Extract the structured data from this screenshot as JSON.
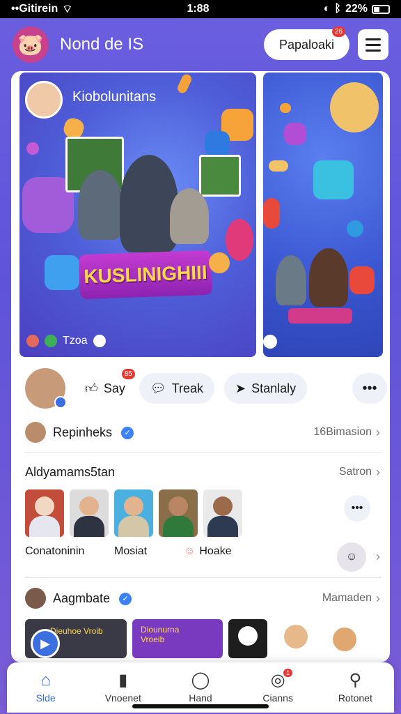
{
  "status": {
    "carrier": "••Gitirein",
    "time": "1:88",
    "battery": "22%"
  },
  "header": {
    "title": "Nond de IS",
    "pill_label": "Papaloaki",
    "pill_badge": "26"
  },
  "banner": {
    "title": "Kiobolunitans",
    "ribbon_text": "KUSLINIGHIII",
    "footer_text": "Tzoa"
  },
  "actions": {
    "say_label": "Say",
    "say_badge": "85",
    "treak_label": "Treak",
    "stanlaly_label": "Stanlaly",
    "more_label": "•••"
  },
  "section1": {
    "title": "Repinheks",
    "link": "16Bimasion"
  },
  "section2": {
    "title": "Aldyamams5tan",
    "link": "Satron",
    "labels": [
      "Conatoninin",
      "Mosiat",
      "Hoake"
    ]
  },
  "section3": {
    "title": "Aagmbate",
    "link": "Mamaden"
  },
  "bottom_thumbs": {
    "card1_text": "Dieuhoe Vroib",
    "card2_text": "Diounurna Vroeib"
  },
  "tabs": [
    {
      "label": "Slde",
      "icon": "home-icon"
    },
    {
      "label": "Vnoenet",
      "icon": "shop-icon"
    },
    {
      "label": "Hand",
      "icon": "chat-icon"
    },
    {
      "label": "Cianns",
      "icon": "notifications-icon",
      "badge": "1"
    },
    {
      "label": "Rotonet",
      "icon": "search-icon"
    }
  ],
  "colors": {
    "accent": "#3b6fe0",
    "badge": "#e53935",
    "background": "#6b5fe0"
  }
}
